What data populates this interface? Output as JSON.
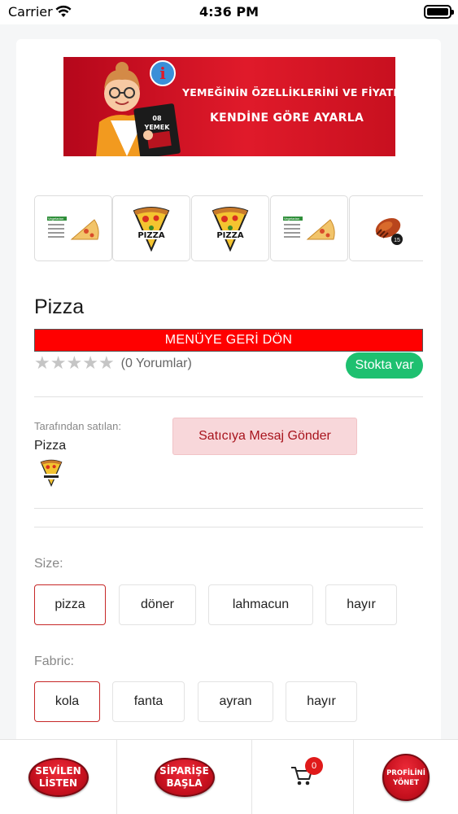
{
  "status_bar": {
    "carrier": "Carrier",
    "time": "4:36 PM"
  },
  "banner": {
    "line1": "YEMEĞİNİN ÖZELLİKLERİNİ VE FİYATINI",
    "line2": "KENDİNE GÖRE AYARLA",
    "menu_line1": "08",
    "menu_line2": "YEMEK"
  },
  "thumbnails": [
    {
      "name": "vegetarian-pizza-menu-card",
      "caption": "Vegetarian"
    },
    {
      "name": "pizza-logo",
      "caption": "PIZZA"
    },
    {
      "name": "pizza-logo",
      "caption": "PIZZA"
    },
    {
      "name": "vegetarian-pizza-menu-card",
      "caption": "Vegetarian"
    },
    {
      "name": "grilled-food-photo",
      "caption": "15"
    }
  ],
  "product": {
    "title": "Pizza",
    "back_button": "MENÜYE GERİ DÖN",
    "rating_stars": 0,
    "rating_max": 5,
    "review_count": "(0 Yorumlar)",
    "stock_status": "Stokta var"
  },
  "seller": {
    "caption": "Tarafından satılan:",
    "name": "Pizza",
    "message_button": "Satıcıya Mesaj Gönder"
  },
  "options": {
    "size": {
      "label": "Size:",
      "items": [
        "pizza",
        "döner",
        "lahmacun",
        "hayır"
      ],
      "selected": "pizza"
    },
    "fabric": {
      "label": "Fabric:",
      "items": [
        "kola",
        "fanta",
        "ayran",
        "hayır"
      ],
      "selected": "kola"
    }
  },
  "bottom_nav": {
    "favorites_line1": "SEVİLEN",
    "favorites_line2": "LİSTEN",
    "order_line1": "SİPARİŞE",
    "order_line2": "BAŞLA",
    "cart_count": "0",
    "profile_line1": "PROFİLİNİ",
    "profile_line2": "YÖNET"
  },
  "colors": {
    "accent_red": "#ff0000",
    "stock_green": "#1ec070",
    "message_bg": "#f8d7da",
    "selected_border": "#c62828"
  }
}
